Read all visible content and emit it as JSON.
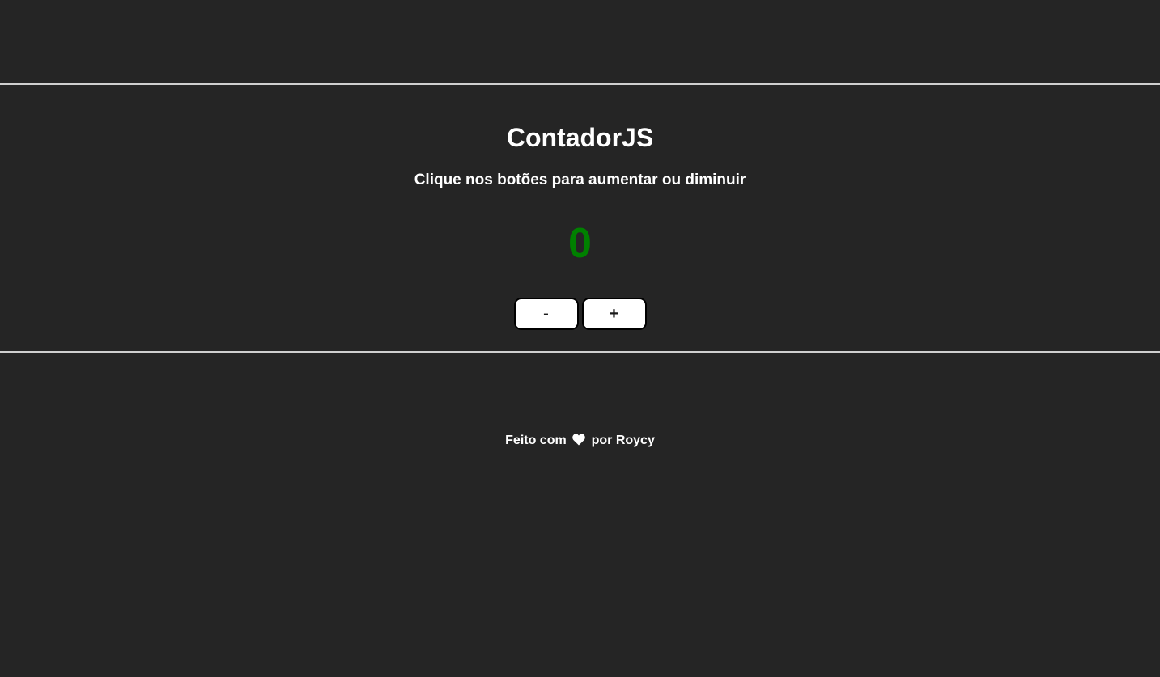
{
  "header": {
    "title": "ContadorJS",
    "subtitle": "Clique nos botões para aumentar ou diminuir"
  },
  "counter": {
    "value": "0",
    "color": "#008000"
  },
  "controls": {
    "decrement_label": "-",
    "increment_label": "+"
  },
  "footer": {
    "prefix": "Feito com",
    "icon": "heart-icon",
    "suffix": "por Roycy"
  },
  "colors": {
    "background": "#252525",
    "text": "#ffffff",
    "rule": "#d0d0d0",
    "button_bg": "#ffffff",
    "button_border": "#000000"
  }
}
